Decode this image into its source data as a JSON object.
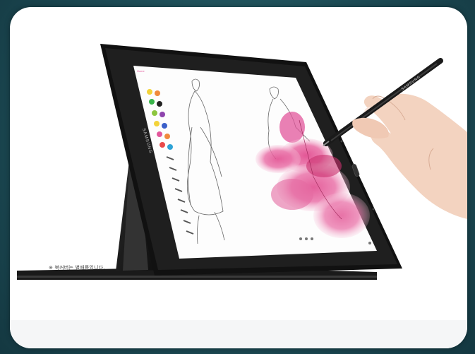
{
  "brand_label": "SAMSUNG",
  "stylus_brand_label": "SAMSUNG",
  "caption": "※ 북커버는 별매품입니다.",
  "palette_colors": [
    "#e84a4a",
    "#f08a3c",
    "#f3d33a",
    "#8dc63f",
    "#39b54a",
    "#2ea3d6",
    "#3b5fc9",
    "#8e44ad",
    "#e2569b",
    "#6b4a2b",
    "#222222",
    "#ffffff"
  ],
  "accent_color": "#d6457a"
}
